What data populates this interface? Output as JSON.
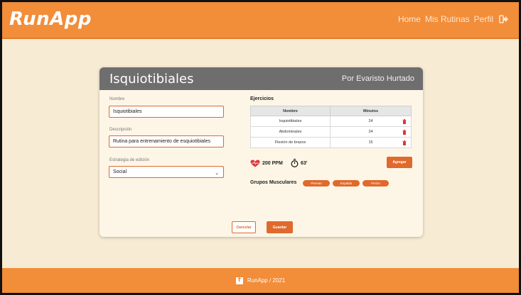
{
  "header": {
    "logo": "RunApp",
    "nav": [
      {
        "label": "Home"
      },
      {
        "label": "Mis Rutinas"
      },
      {
        "label": "Perfil"
      }
    ]
  },
  "card": {
    "title": "Isquiotibiales",
    "author": "Por Evaristo Hurtado",
    "nombre_label": "Nombre",
    "nombre_value": "Isquiotibiales",
    "descripcion_label": "Descripción",
    "descripcion_value": "Rutina para entrenamiento de esquiotibiales",
    "estrategia_label": "Estrategia de edición",
    "estrategia_value": "Social",
    "ejercicios_title": "Ejercicios",
    "table": {
      "headers": [
        "Nombre",
        "Minutos"
      ],
      "rows": [
        {
          "nombre": "Isquiotibiales",
          "minutos": "24"
        },
        {
          "nombre": "Abdominales",
          "minutos": "24"
        },
        {
          "nombre": "Flexión de brazos",
          "minutos": "15"
        }
      ]
    },
    "ppm": "200 PPM",
    "tiempo": "63'",
    "agregar_label": "Agregar",
    "grupos_title": "Grupos Musculares",
    "grupos": [
      "Piernas",
      "Espalda",
      "Pecho"
    ],
    "cancelar_label": "Cancelar",
    "guardar_label": "Guardar"
  },
  "footer": {
    "text": "RunApp / 2021"
  },
  "colors": {
    "brand": "#f28d3a",
    "accent": "#e0692c",
    "background": "#f7ebd4",
    "card_header": "#6e6e6e",
    "heart": "#e0343a"
  }
}
